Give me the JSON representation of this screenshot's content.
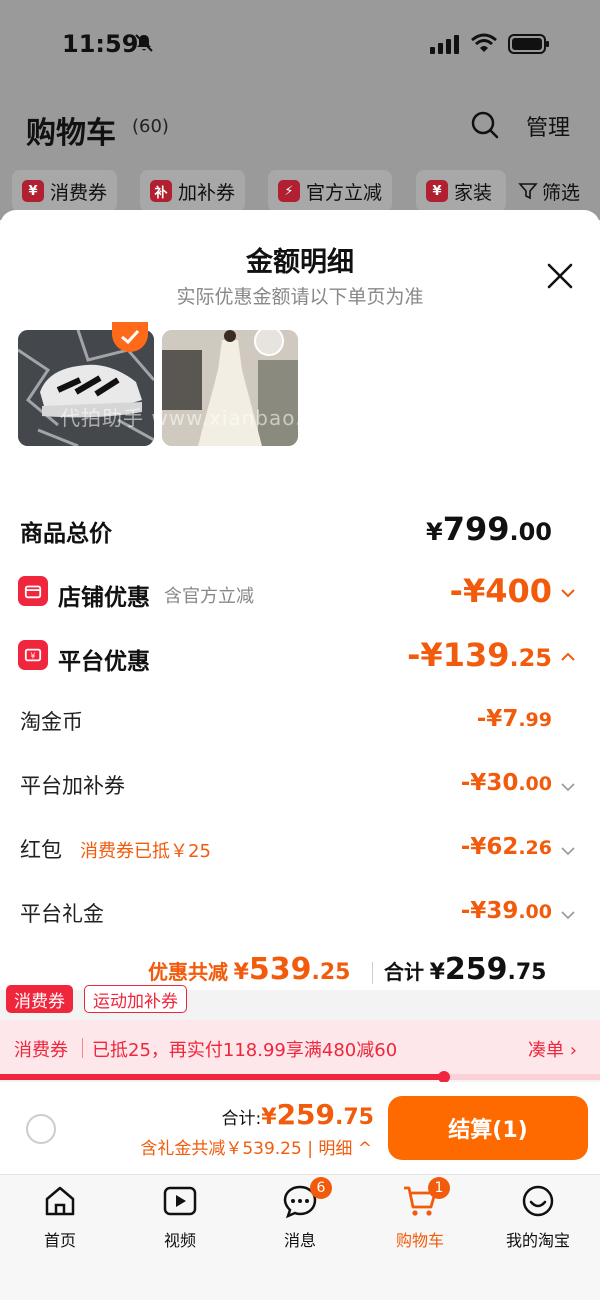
{
  "status_bar": {
    "time": "11:59"
  },
  "cart_header": {
    "title": "购物车",
    "count": "(60)",
    "manage_label": "管理",
    "chips": [
      {
        "icon_text": "¥",
        "label": "消费券"
      },
      {
        "icon_text": "补",
        "label": "加补券"
      },
      {
        "icon_text": "⚡",
        "label": "官方立减"
      },
      {
        "icon_text": "¥",
        "label": "家装"
      }
    ],
    "filter_label": "筛选"
  },
  "sheet": {
    "title": "金额明细",
    "subtitle": "实际优惠金额请以下单页为准",
    "watermark": "代拍助手 www.xianbao.run",
    "total_price": {
      "label": "商品总价",
      "yen": "¥",
      "int": "799",
      "dec": ".00"
    },
    "store_discount": {
      "label": "店铺优惠",
      "note": "含官方立减",
      "amount": "-¥400"
    },
    "platform_discount": {
      "label": "平台优惠",
      "int": "-¥139",
      "dec": ".25"
    },
    "items": [
      {
        "label": "淘金币",
        "note": "",
        "int": "-¥7",
        "dec": ".99"
      },
      {
        "label": "平台加补券",
        "note": "",
        "int": "-¥30",
        "dec": ".00"
      },
      {
        "label": "红包",
        "note": "消费券已抵￥25",
        "int": "-¥62",
        "dec": ".26"
      },
      {
        "label": "平台礼金",
        "note": "",
        "int": "-¥39",
        "dec": ".00"
      }
    ],
    "summary": {
      "discount_label": "优惠共减",
      "discount_yen": "¥",
      "discount_int": "539",
      "discount_dec": ".25",
      "total_label": "合计",
      "total_yen": "¥",
      "total_int": "259",
      "total_dec": ".75"
    }
  },
  "coupon_tags": [
    "消费券",
    "运动加补券"
  ],
  "voucher_bar": {
    "label": "消费券",
    "text": "已抵25，再实付118.99享满480减60",
    "link": "凑单 ›",
    "progress": 0.74
  },
  "checkout": {
    "total_key": "合计:",
    "total_yen": "¥",
    "total_int": "259",
    "total_dec": ".75",
    "detail": "含礼金共减￥539.25 | 明细 ^",
    "button": "结算(1)"
  },
  "tabbar": [
    {
      "label": "首页",
      "icon": "home-icon"
    },
    {
      "label": "视频",
      "icon": "video-icon"
    },
    {
      "label": "消息",
      "icon": "message-icon",
      "badge": "6"
    },
    {
      "label": "购物车",
      "icon": "cart-icon",
      "badge": "1"
    },
    {
      "label": "我的淘宝",
      "icon": "profile-icon"
    }
  ],
  "colors": {
    "accent": "#f25b0c",
    "red": "#f0263c",
    "button": "#ff6a00"
  }
}
